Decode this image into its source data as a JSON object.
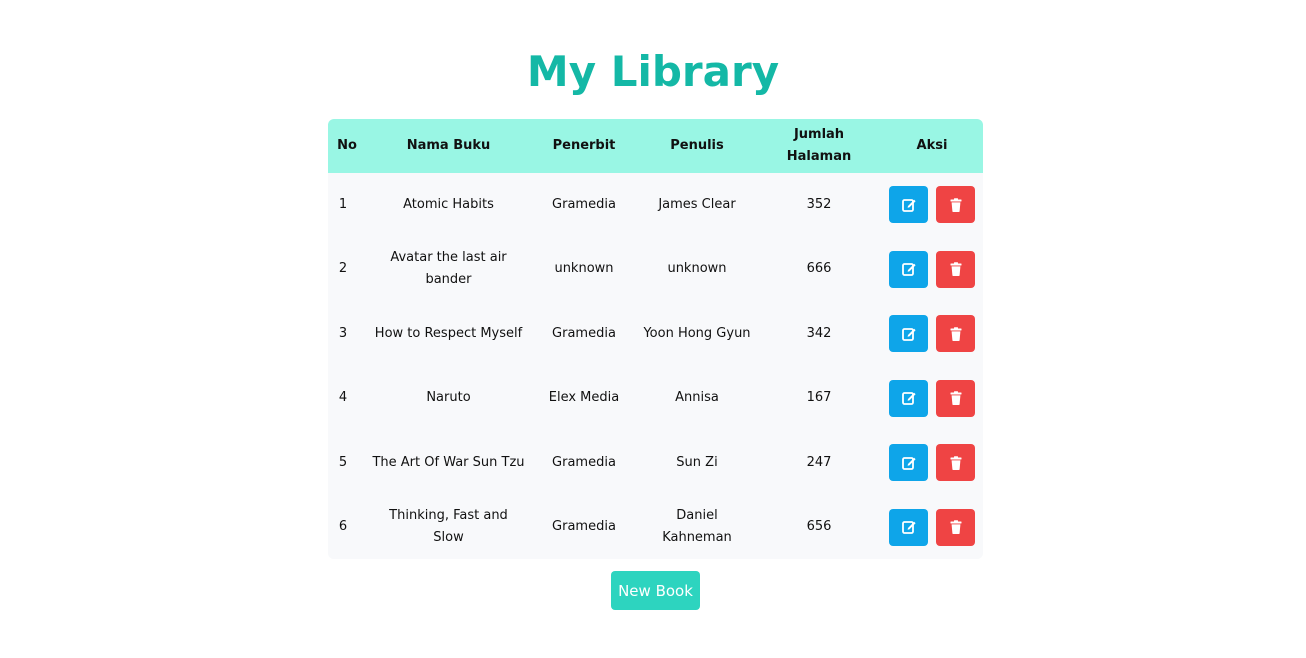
{
  "page": {
    "title": "My Library"
  },
  "table": {
    "headers": {
      "no": "No",
      "nama_buku": "Nama Buku",
      "penerbit": "Penerbit",
      "penulis": "Penulis",
      "jumlah_halaman": "Jumlah Halaman",
      "aksi": "Aksi"
    },
    "rows": [
      {
        "no": "1",
        "nama_buku": "Atomic Habits",
        "penerbit": "Gramedia",
        "penulis": "James Clear",
        "jumlah_halaman": "352"
      },
      {
        "no": "2",
        "nama_buku": "Avatar the last air bander",
        "penerbit": "unknown",
        "penulis": "unknown",
        "jumlah_halaman": "666"
      },
      {
        "no": "3",
        "nama_buku": "How to Respect Myself",
        "penerbit": "Gramedia",
        "penulis": "Yoon Hong Gyun",
        "jumlah_halaman": "342"
      },
      {
        "no": "4",
        "nama_buku": "Naruto",
        "penerbit": "Elex Media",
        "penulis": "Annisa",
        "jumlah_halaman": "167"
      },
      {
        "no": "5",
        "nama_buku": "The Art Of War Sun Tzu",
        "penerbit": "Gramedia",
        "penulis": "Sun Zi",
        "jumlah_halaman": "247"
      },
      {
        "no": "6",
        "nama_buku": "Thinking, Fast and Slow",
        "penerbit": "Gramedia",
        "penulis": "Daniel Kahneman",
        "jumlah_halaman": "656"
      }
    ],
    "action_icons": {
      "edit": "edit-icon",
      "delete": "trash-icon"
    }
  },
  "footer": {
    "new_book_label": "New Book"
  },
  "colors": {
    "title": "#14b8a6",
    "header_bg": "#99f6e4",
    "edit_button": "#0ea5e9",
    "delete_button": "#ef4444",
    "new_book_button": "#2dd4bf"
  }
}
